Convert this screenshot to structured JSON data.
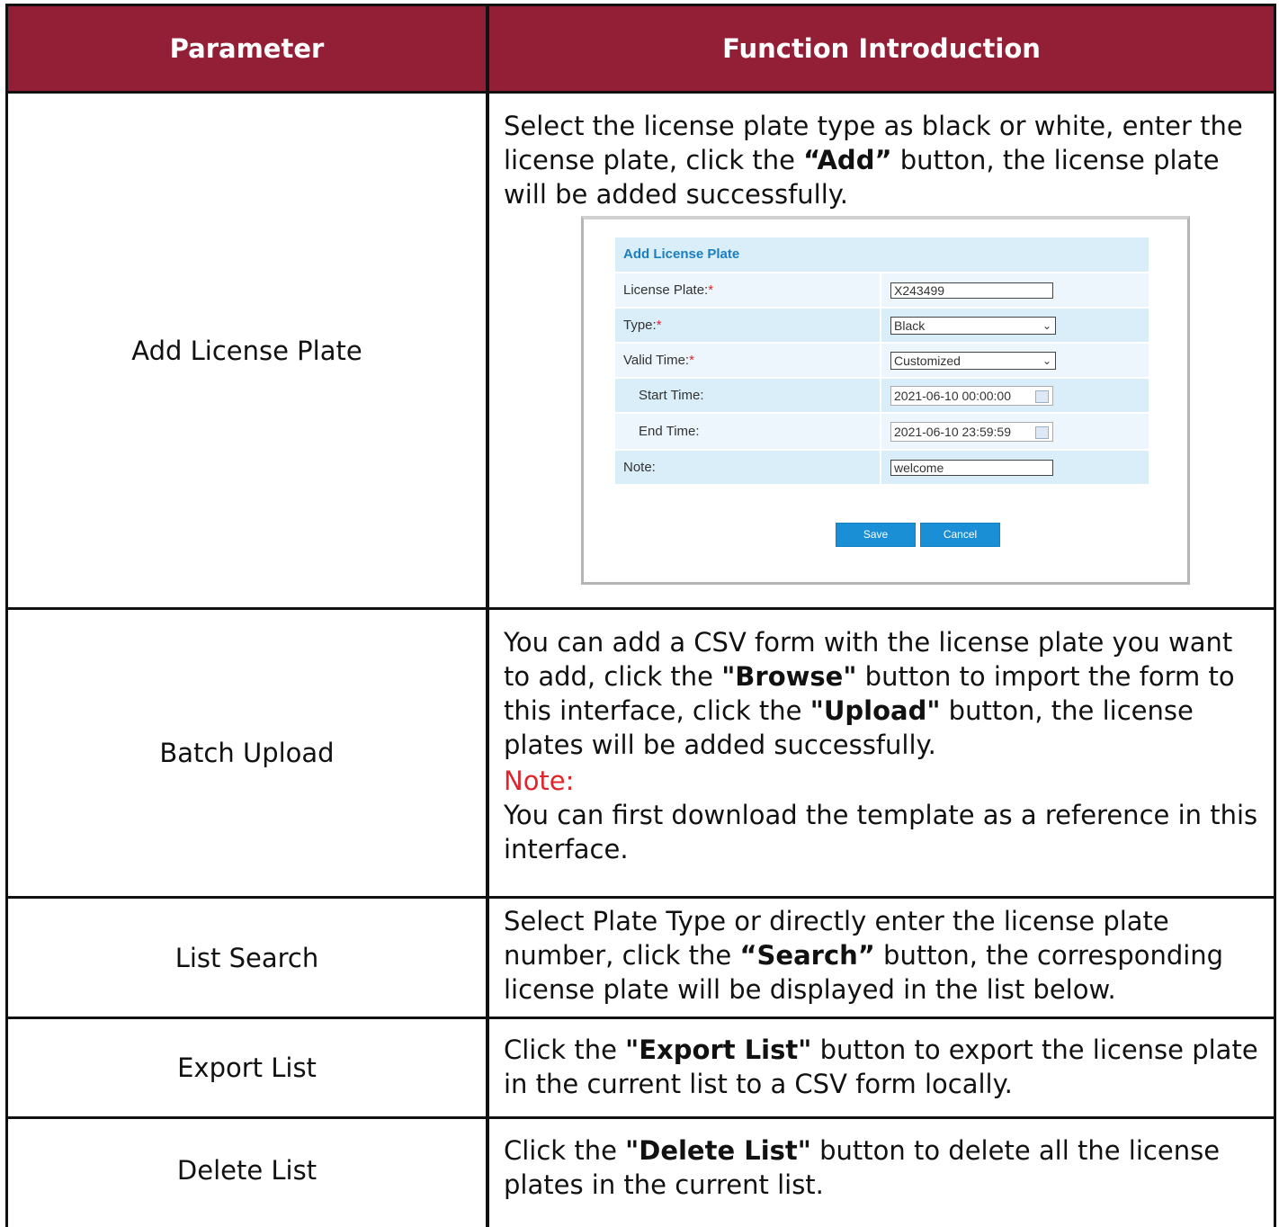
{
  "header": {
    "parameter": "Parameter",
    "function": "Function Introduction"
  },
  "rows": [
    {
      "parameter": "Add License Plate",
      "text_before": "Select the license plate type as black or white, enter the license plate, click the ",
      "bold": "“Add”",
      "text_after": " button, the license plate will be added successfully."
    },
    {
      "parameter": "Batch Upload",
      "t1": "You can add a CSV form with the license plate you want to add, click the ",
      "b1": "\"Browse\"",
      "t2": " button to import the form to this interface, click the ",
      "b2": "\"Upload\"",
      "t3": " button, the license plates will be added successfully.",
      "note_label": "Note:",
      "note_text": "You can first download the template as a reference in this interface."
    },
    {
      "parameter": "List Search",
      "text_before": "Select Plate Type or directly enter the license plate number, click the ",
      "bold": "“Search”",
      "text_after": " button, the corresponding license plate will be displayed in the list below."
    },
    {
      "parameter": "Export List",
      "text_before": "Click the ",
      "bold": "\"Export List\"",
      "text_after": " button to export the license plate in the current list to a CSV form locally."
    },
    {
      "parameter": "Delete  List",
      "text_before": "Click the ",
      "bold": "\"Delete List\"",
      "text_after": " button to delete all the license plates in the current list."
    }
  ],
  "form": {
    "title": "Add License Plate",
    "license_plate_label": "License Plate:",
    "license_plate_value": "X243499",
    "type_label": "Type:",
    "type_value": "Black",
    "valid_time_label": "Valid Time:",
    "valid_time_value": "Customized",
    "start_time_label": "Start Time:",
    "start_time_value": "2021-06-10 00:00:00",
    "end_time_label": "End Time:",
    "end_time_value": "2021-06-10 23:59:59",
    "note_label": "Note:",
    "note_value": "welcome",
    "required_mark": "*",
    "save_label": "Save",
    "cancel_label": "Cancel"
  },
  "colors": {
    "header_bg": "#921f36",
    "note_red": "#e0242c",
    "button_blue": "#1a8fd6",
    "form_row_blue": "#d9eef9"
  }
}
